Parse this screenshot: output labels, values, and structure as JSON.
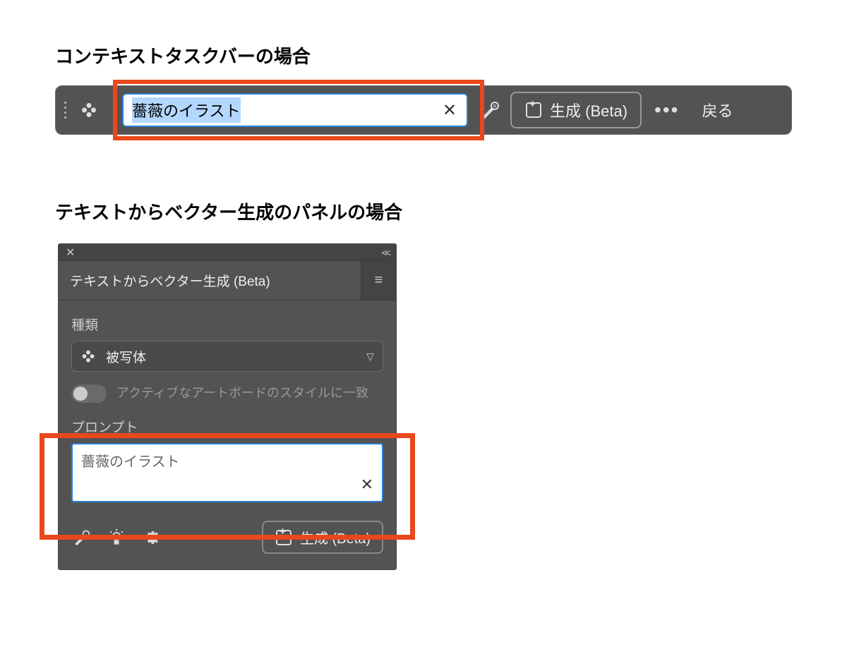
{
  "section1": {
    "heading": "コンテキストタスクバーの場合"
  },
  "taskbar": {
    "prompt_value": "薔薇のイラスト",
    "generate_label": "生成 (Beta)",
    "back_label": "戻る",
    "more_symbol": "•••"
  },
  "section2": {
    "heading": "テキストからベクター生成のパネルの場合"
  },
  "panel": {
    "title": "テキストからベクター生成 (Beta)",
    "type_label": "種類",
    "type_value": "被写体",
    "match_style_label": "アクティブなアートボードのスタイルに一致",
    "prompt_label": "プロンプト",
    "prompt_value": "薔薇のイラスト",
    "generate_label": "生成 (Beta)"
  }
}
